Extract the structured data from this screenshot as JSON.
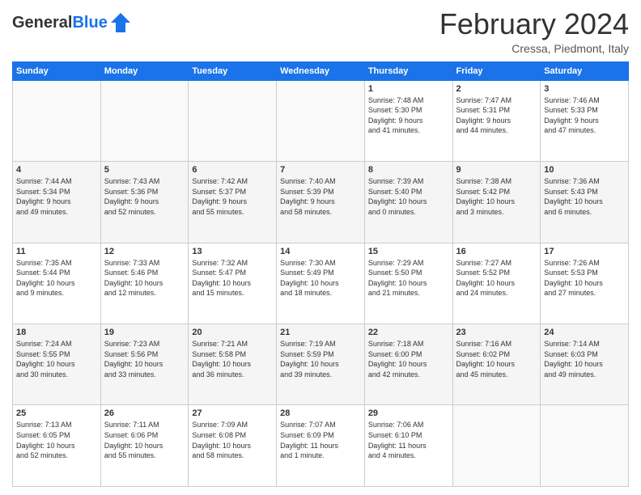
{
  "header": {
    "logo_general": "General",
    "logo_blue": "Blue",
    "title": "February 2024",
    "subtitle": "Cressa, Piedmont, Italy"
  },
  "days_of_week": [
    "Sunday",
    "Monday",
    "Tuesday",
    "Wednesday",
    "Thursday",
    "Friday",
    "Saturday"
  ],
  "weeks": [
    [
      {
        "day": "",
        "info": ""
      },
      {
        "day": "",
        "info": ""
      },
      {
        "day": "",
        "info": ""
      },
      {
        "day": "",
        "info": ""
      },
      {
        "day": "1",
        "info": "Sunrise: 7:48 AM\nSunset: 5:30 PM\nDaylight: 9 hours\nand 41 minutes."
      },
      {
        "day": "2",
        "info": "Sunrise: 7:47 AM\nSunset: 5:31 PM\nDaylight: 9 hours\nand 44 minutes."
      },
      {
        "day": "3",
        "info": "Sunrise: 7:46 AM\nSunset: 5:33 PM\nDaylight: 9 hours\nand 47 minutes."
      }
    ],
    [
      {
        "day": "4",
        "info": "Sunrise: 7:44 AM\nSunset: 5:34 PM\nDaylight: 9 hours\nand 49 minutes."
      },
      {
        "day": "5",
        "info": "Sunrise: 7:43 AM\nSunset: 5:36 PM\nDaylight: 9 hours\nand 52 minutes."
      },
      {
        "day": "6",
        "info": "Sunrise: 7:42 AM\nSunset: 5:37 PM\nDaylight: 9 hours\nand 55 minutes."
      },
      {
        "day": "7",
        "info": "Sunrise: 7:40 AM\nSunset: 5:39 PM\nDaylight: 9 hours\nand 58 minutes."
      },
      {
        "day": "8",
        "info": "Sunrise: 7:39 AM\nSunset: 5:40 PM\nDaylight: 10 hours\nand 0 minutes."
      },
      {
        "day": "9",
        "info": "Sunrise: 7:38 AM\nSunset: 5:42 PM\nDaylight: 10 hours\nand 3 minutes."
      },
      {
        "day": "10",
        "info": "Sunrise: 7:36 AM\nSunset: 5:43 PM\nDaylight: 10 hours\nand 6 minutes."
      }
    ],
    [
      {
        "day": "11",
        "info": "Sunrise: 7:35 AM\nSunset: 5:44 PM\nDaylight: 10 hours\nand 9 minutes."
      },
      {
        "day": "12",
        "info": "Sunrise: 7:33 AM\nSunset: 5:46 PM\nDaylight: 10 hours\nand 12 minutes."
      },
      {
        "day": "13",
        "info": "Sunrise: 7:32 AM\nSunset: 5:47 PM\nDaylight: 10 hours\nand 15 minutes."
      },
      {
        "day": "14",
        "info": "Sunrise: 7:30 AM\nSunset: 5:49 PM\nDaylight: 10 hours\nand 18 minutes."
      },
      {
        "day": "15",
        "info": "Sunrise: 7:29 AM\nSunset: 5:50 PM\nDaylight: 10 hours\nand 21 minutes."
      },
      {
        "day": "16",
        "info": "Sunrise: 7:27 AM\nSunset: 5:52 PM\nDaylight: 10 hours\nand 24 minutes."
      },
      {
        "day": "17",
        "info": "Sunrise: 7:26 AM\nSunset: 5:53 PM\nDaylight: 10 hours\nand 27 minutes."
      }
    ],
    [
      {
        "day": "18",
        "info": "Sunrise: 7:24 AM\nSunset: 5:55 PM\nDaylight: 10 hours\nand 30 minutes."
      },
      {
        "day": "19",
        "info": "Sunrise: 7:23 AM\nSunset: 5:56 PM\nDaylight: 10 hours\nand 33 minutes."
      },
      {
        "day": "20",
        "info": "Sunrise: 7:21 AM\nSunset: 5:58 PM\nDaylight: 10 hours\nand 36 minutes."
      },
      {
        "day": "21",
        "info": "Sunrise: 7:19 AM\nSunset: 5:59 PM\nDaylight: 10 hours\nand 39 minutes."
      },
      {
        "day": "22",
        "info": "Sunrise: 7:18 AM\nSunset: 6:00 PM\nDaylight: 10 hours\nand 42 minutes."
      },
      {
        "day": "23",
        "info": "Sunrise: 7:16 AM\nSunset: 6:02 PM\nDaylight: 10 hours\nand 45 minutes."
      },
      {
        "day": "24",
        "info": "Sunrise: 7:14 AM\nSunset: 6:03 PM\nDaylight: 10 hours\nand 49 minutes."
      }
    ],
    [
      {
        "day": "25",
        "info": "Sunrise: 7:13 AM\nSunset: 6:05 PM\nDaylight: 10 hours\nand 52 minutes."
      },
      {
        "day": "26",
        "info": "Sunrise: 7:11 AM\nSunset: 6:06 PM\nDaylight: 10 hours\nand 55 minutes."
      },
      {
        "day": "27",
        "info": "Sunrise: 7:09 AM\nSunset: 6:08 PM\nDaylight: 10 hours\nand 58 minutes."
      },
      {
        "day": "28",
        "info": "Sunrise: 7:07 AM\nSunset: 6:09 PM\nDaylight: 11 hours\nand 1 minute."
      },
      {
        "day": "29",
        "info": "Sunrise: 7:06 AM\nSunset: 6:10 PM\nDaylight: 11 hours\nand 4 minutes."
      },
      {
        "day": "",
        "info": ""
      },
      {
        "day": "",
        "info": ""
      }
    ]
  ]
}
